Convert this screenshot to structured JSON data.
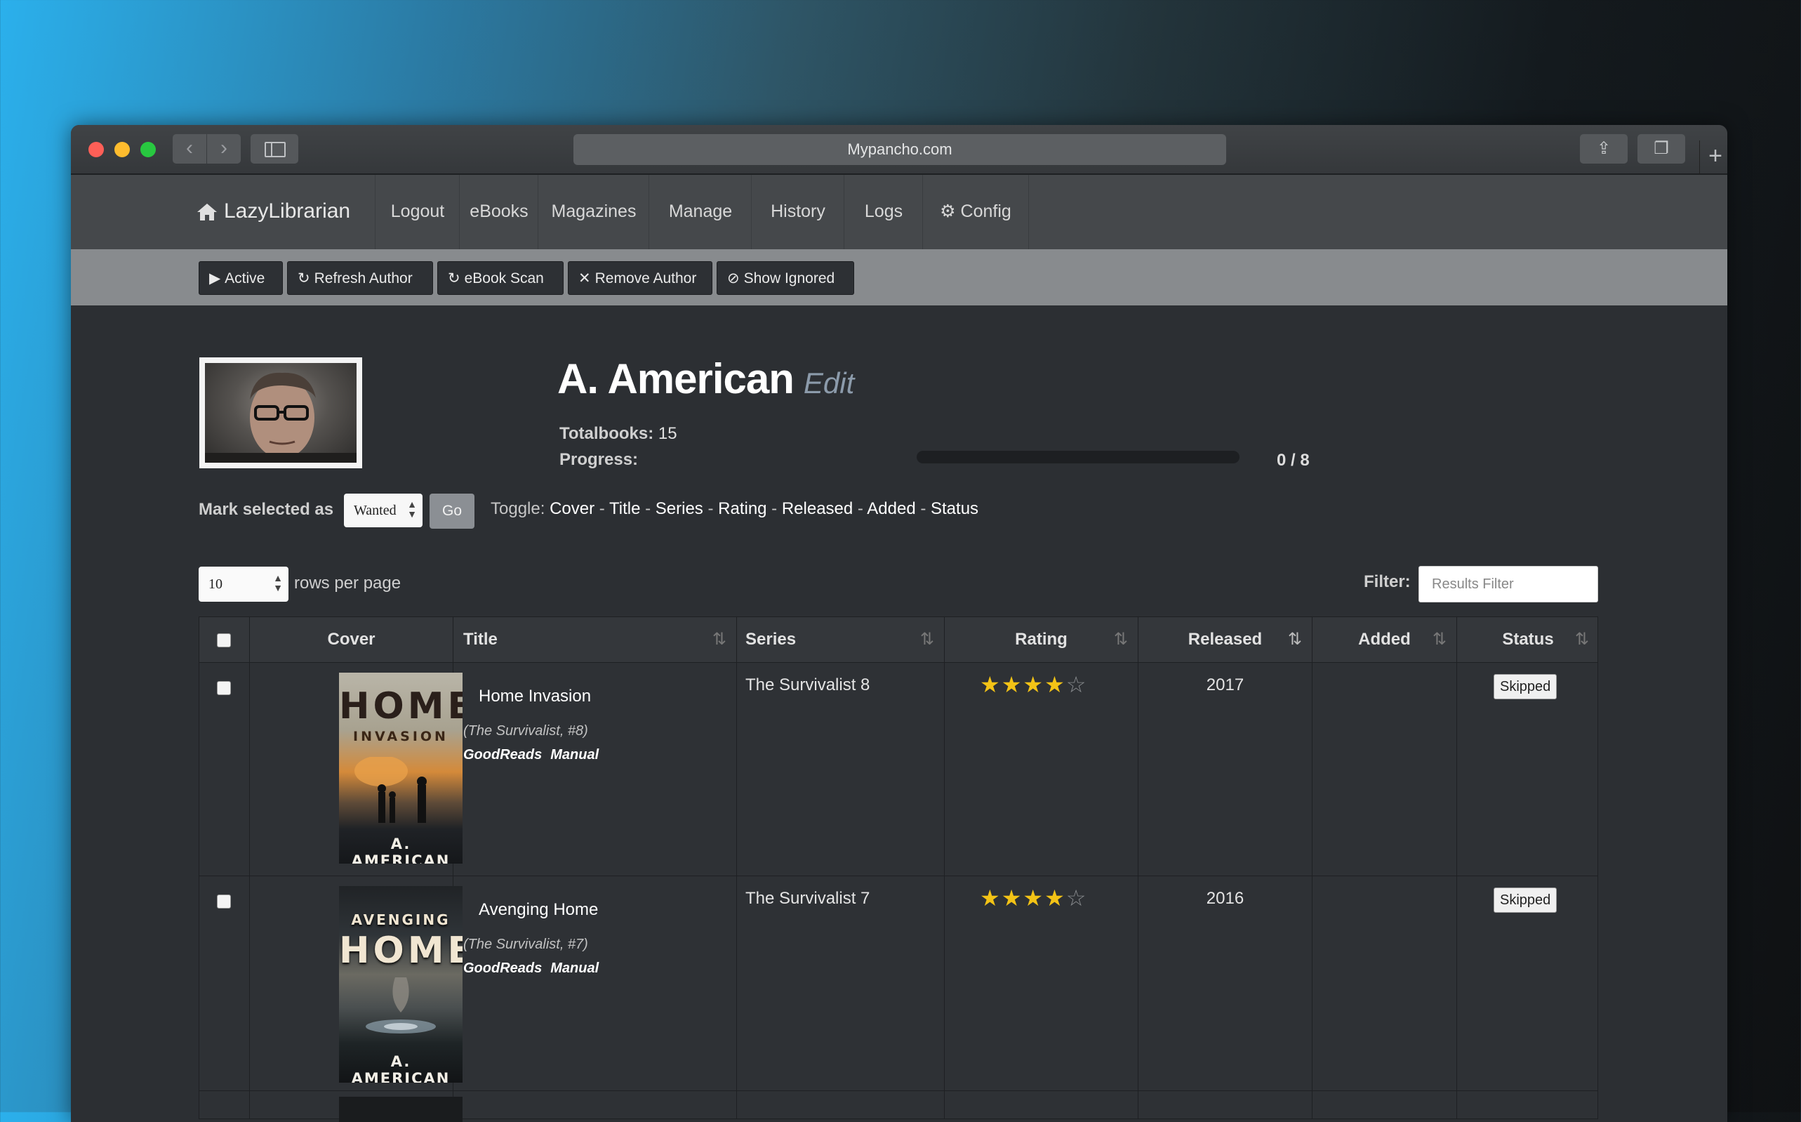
{
  "browser": {
    "url": "Mypancho.com"
  },
  "nav": {
    "brand": "LazyLibrarian",
    "items": [
      "Logout",
      "eBooks",
      "Magazines",
      "Manage",
      "History",
      "Logs",
      "Config"
    ]
  },
  "subnav": {
    "buttons": [
      "Active",
      "Refresh Author",
      "eBook Scan",
      "Remove Author",
      "Show Ignored"
    ]
  },
  "author": {
    "name": "A. American",
    "edit": "Edit",
    "totalbooks_label": "Totalbooks:",
    "totalbooks": "15",
    "progress_label": "Progress:",
    "progress_text": "0 / 8",
    "progress_fraction": 0
  },
  "mark": {
    "label": "Mark selected as",
    "selected": "Wanted",
    "go": "Go"
  },
  "toggle": {
    "label": "Toggle:",
    "items": [
      "Cover",
      "Title",
      "Series",
      "Rating",
      "Released",
      "Added",
      "Status"
    ],
    "sep": " - "
  },
  "paging": {
    "rows": "10",
    "rows_label": "rows per page"
  },
  "filter": {
    "label": "Filter:",
    "placeholder": "Results Filter"
  },
  "table": {
    "headers": [
      "Cover",
      "Title",
      "Series",
      "Rating",
      "Released",
      "Added",
      "Status"
    ],
    "sort_glyph": "⇅",
    "rows": [
      {
        "cover_top": "HOME",
        "cover_sub": "INVASION",
        "cover_author": "A. AMERICAN",
        "title": "Home Invasion",
        "series_note": "(The Survivalist, #8)",
        "links": [
          "GoodReads",
          "Manual"
        ],
        "series": "The Survivalist 8",
        "rating": 4,
        "released": "2017",
        "added": "",
        "status": "Skipped"
      },
      {
        "cover_top": "AVENGING",
        "cover_sub": "HOME",
        "cover_author": "A. AMERICAN",
        "title": "Avenging Home",
        "series_note": "(The Survivalist, #7)",
        "links": [
          "GoodReads",
          "Manual"
        ],
        "series": "The Survivalist 7",
        "rating": 4,
        "released": "2016",
        "added": "",
        "status": "Skipped"
      }
    ]
  },
  "colors": {
    "star": "#f3c316",
    "navbar": "#45484b",
    "subbar": "#888b8e"
  }
}
